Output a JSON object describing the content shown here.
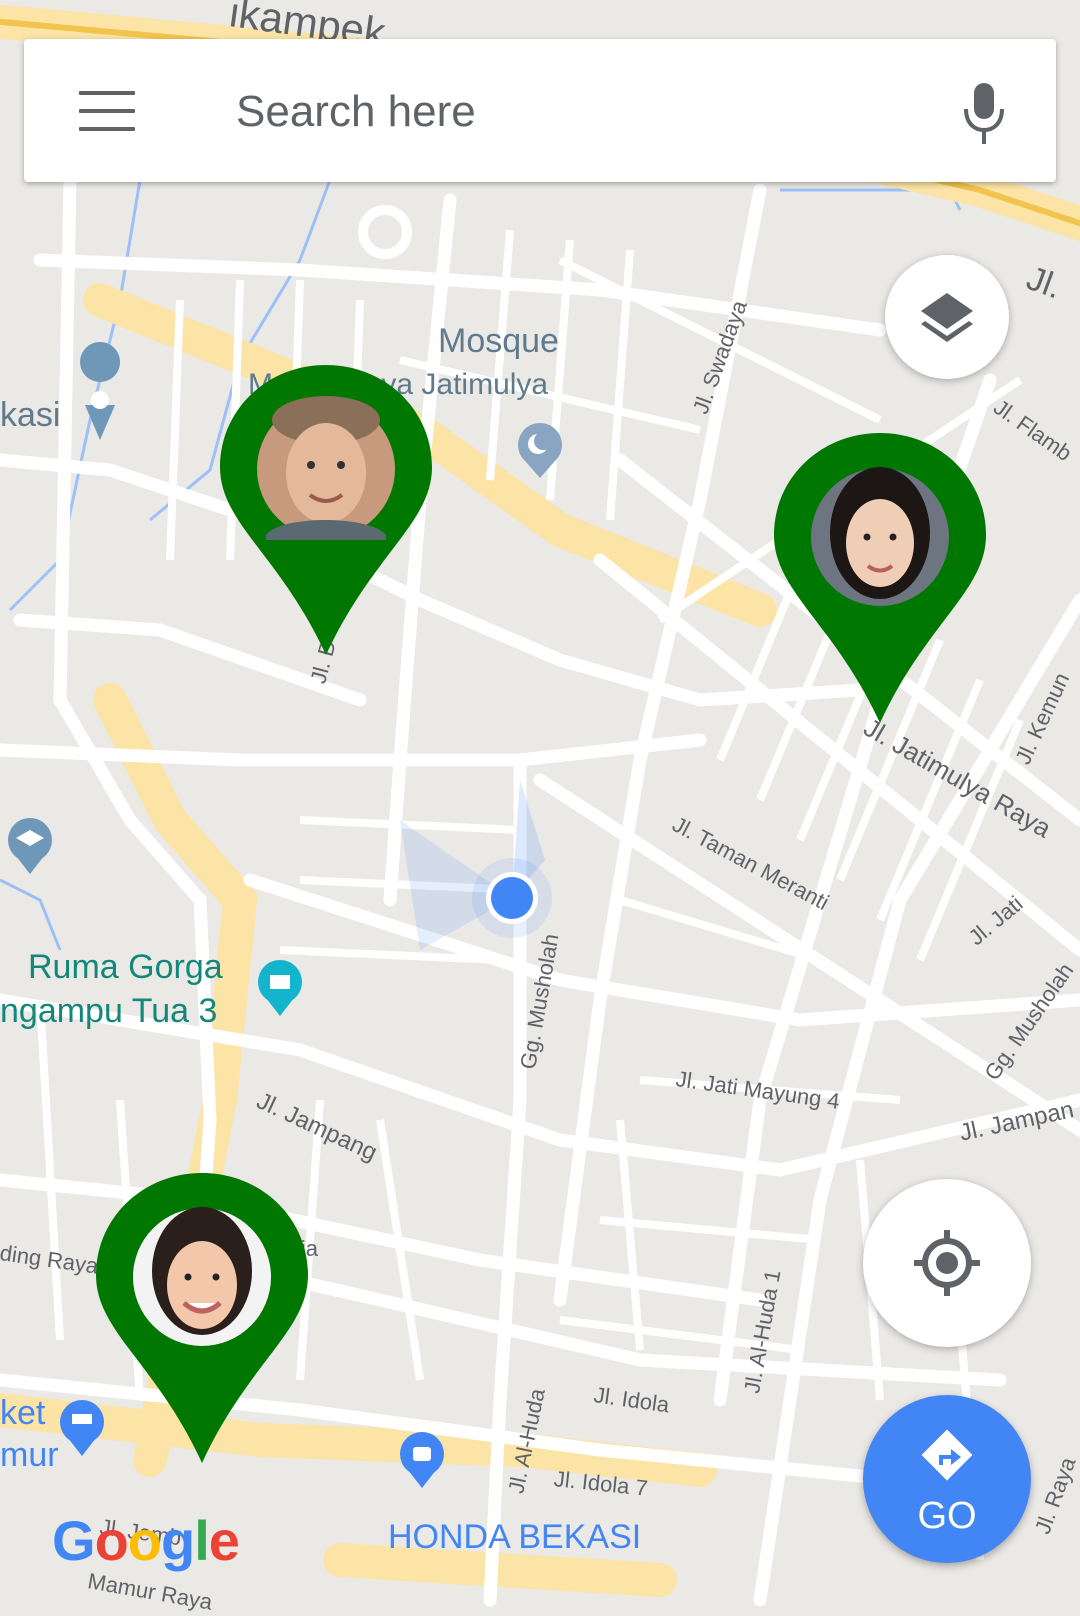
{
  "search": {
    "placeholder": "Search here"
  },
  "icons": {
    "menu": "hamburger-menu-icon",
    "mic": "microphone-icon",
    "layers": "layers-icon",
    "locate": "my-location-icon",
    "directions": "directions-icon"
  },
  "colors": {
    "pin": "#007700",
    "user_dot": "#4285f4",
    "go_button": "#4285f4",
    "poi_teal": "#12877a",
    "road_label": "#5f6368"
  },
  "map_labels": {
    "poi_mosque": "Mosque",
    "poi_mosque_name": "Masjid Raya Jatimulya",
    "poi_kasi": "kasi",
    "poi_ruma": "Ruma Gorga",
    "poi_ruma2": "ngampu Tua 3",
    "poi_ket": "ket",
    "poi_mur": "mur",
    "poi_honda": "HONDA BEKASI",
    "road_kampek": "ikampek",
    "road_jl_top": "Jl.",
    "road_swadaya": "Jl. Swadaya",
    "road_flamb": "Jl. Flamb",
    "road_jl_d": "Jl. D",
    "road_jatimulya_raya": "Jl. Jatimulya Raya",
    "road_kemun": "Jl. Kemun",
    "road_taman_meranti": "Jl. Taman Meranti",
    "road_jati": "Jl. Jati",
    "road_musholah": "Gg. Musholah",
    "road_musholah2": "Gg. Musholah",
    "road_jati_mayung": "Jl. Jati Mayung 4",
    "road_jampang": "Jl. Jampang",
    "road_jampang2": "Jl. Jampan",
    "road_ding_raya": "ding Raya",
    "road_lia": "lia",
    "road_al_huda_1": "Jl. Al-Huda 1",
    "road_al_huda": "Jl. Al-Huda",
    "road_idola": "Jl. Idola",
    "road_idola_7": "Jl. Idola 7",
    "road_raya": "Jl. Raya",
    "road_jemb": "Jl. Jemb",
    "road_mamur_raya": "Mamur Raya"
  },
  "go_button": {
    "label": "GO"
  },
  "attribution": {
    "logo_text": "Google"
  }
}
